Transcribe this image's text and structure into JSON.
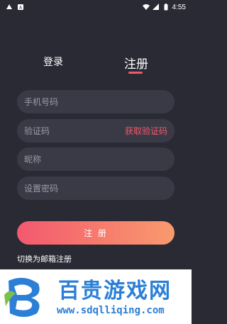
{
  "status_bar": {
    "time": "4:55",
    "left_icons": [
      "notification-icon",
      "app-icon"
    ],
    "right_icons": [
      "wifi-icon",
      "signal-icon",
      "battery-icon"
    ]
  },
  "tabs": {
    "login": "登录",
    "register": "注册",
    "active": "register",
    "accent_color": "#f05a6a"
  },
  "form": {
    "phone_placeholder": "手机号码",
    "code_placeholder": "验证码",
    "get_code_label": "获取验证码",
    "nickname_placeholder": "昵称",
    "password_placeholder": "设置密码",
    "phone_value": "",
    "code_value": "",
    "nickname_value": "",
    "password_value": ""
  },
  "register_button": "注 册",
  "switch_email_label": "切换为邮箱注册",
  "watermark": {
    "title": "百贵游戏网",
    "url": "www.sdqlliqing.com"
  },
  "colors": {
    "background": "#2a2a35",
    "field_bg": "#3a3a47",
    "accent": "#f05a6a",
    "gradient_start": "#f3596f",
    "gradient_end": "#f89a6e"
  }
}
